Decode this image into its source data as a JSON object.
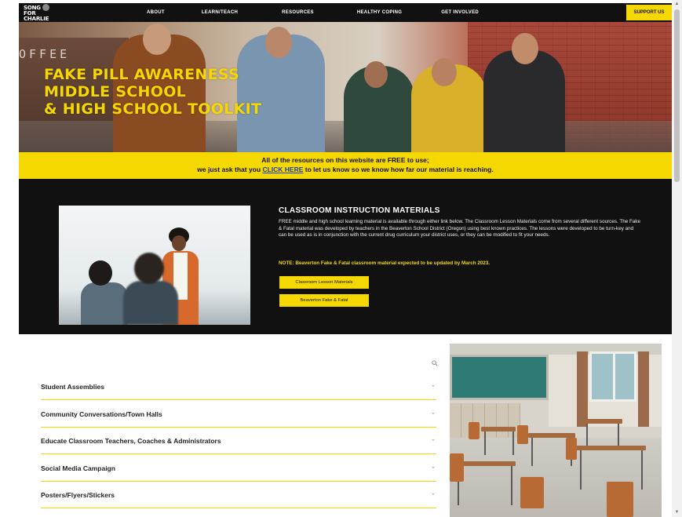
{
  "logo": {
    "line1": "SONG",
    "line2": "FOR",
    "line3": "CHARLIE"
  },
  "nav": {
    "items": [
      {
        "label": "ABOUT"
      },
      {
        "label": "LEARN/TEACH"
      },
      {
        "label": "RESOURCES"
      },
      {
        "label": "HEALTHY COPING"
      },
      {
        "label": "GET INVOLVED"
      }
    ],
    "support_label": "SUPPORT US"
  },
  "hero": {
    "sign_text": "OFFEE",
    "title_line1": "FAKE PILL AWARENESS",
    "title_line2": "MIDDLE SCHOOL",
    "title_line3": "& HIGH SCHOOL TOOLKIT"
  },
  "banner": {
    "line1": "All of the resources on this website are FREE to use;",
    "line2_before": "we just ask that you ",
    "line2_link": "CLICK HERE",
    "line2_after": " to let us know so we know how far our material is reaching."
  },
  "classroom": {
    "title": "CLASSROOM INSTRUCTION MATERIALS",
    "body": "FREE middle and high school learning material is available through either link below. The Classroom Lesson Materials come from several different sources. The Fake & Fatal material was developed by teachers in the Beaverton School District (Oregon) using best known practices. The lessons were developed to be turn-key and can be used as is in conjunction with the current drug curriculum your district uses, or they can be modified to fit your needs.",
    "note": "NOTE: Beaverton Fake & Fatal classroom material expected to be updated by March 2023.",
    "button1": "Classroom Lesson Materials",
    "button2": "Beaverton Fake & Fatal"
  },
  "accordion": {
    "items": [
      {
        "label": "Student Assemblies"
      },
      {
        "label": "Community Conversations/Town Halls"
      },
      {
        "label": "Educate Classroom Teachers, Coaches & Administrators"
      },
      {
        "label": "Social Media Campaign"
      },
      {
        "label": "Posters/Flyers/Stickers"
      }
    ]
  },
  "colors": {
    "accent_yellow": "#f5d800",
    "dark_bg": "#111111",
    "link_blue": "#1a3cc8"
  },
  "icons": {
    "search": "search-icon",
    "chevron": "chevron-down-icon"
  }
}
